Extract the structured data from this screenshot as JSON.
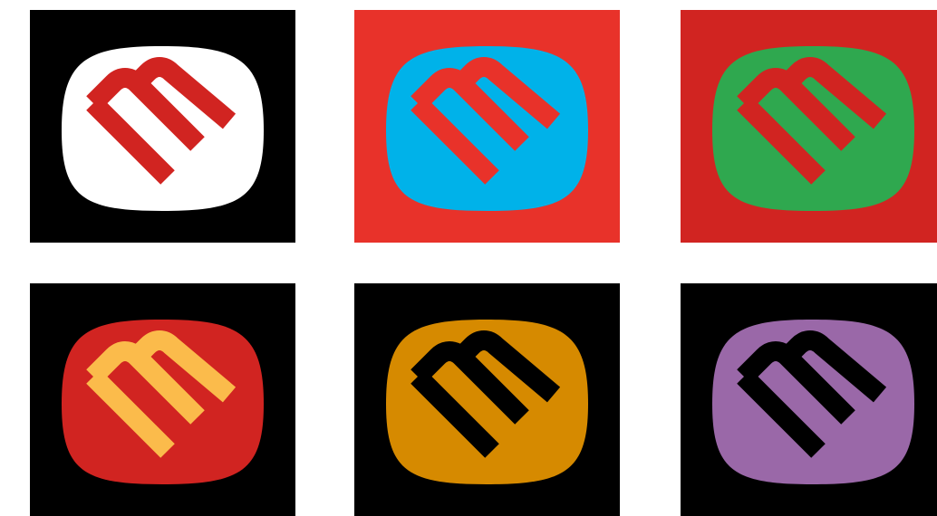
{
  "logo_variants": [
    {
      "name": "black-white-red",
      "background": "#000000",
      "badge": "#ffffff",
      "mark": "#d12421"
    },
    {
      "name": "red-cyan-red",
      "background": "#e8322a",
      "badge": "#00b2e9",
      "mark": "#e8322a"
    },
    {
      "name": "red-green-red",
      "background": "#d12421",
      "badge": "#2fa84f",
      "mark": "#d12421"
    },
    {
      "name": "black-red-yellow",
      "background": "#000000",
      "badge": "#d12421",
      "mark": "#fbbb4b"
    },
    {
      "name": "black-orange-black",
      "background": "#000000",
      "badge": "#d68a00",
      "mark": "#000000"
    },
    {
      "name": "black-purple-black",
      "background": "#000000",
      "badge": "#9a68a8",
      "mark": "#000000"
    }
  ]
}
